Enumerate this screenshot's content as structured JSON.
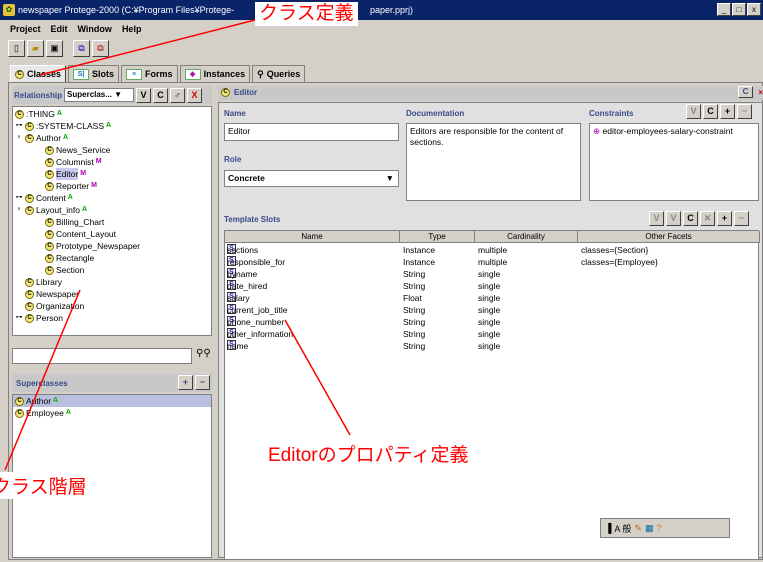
{
  "window": {
    "title": "newspaper  Protege-2000   (C:¥Program Files¥Protege-",
    "title_tail": "paper.pprj)",
    "min": "_",
    "max": "□",
    "close": "x"
  },
  "menu": [
    "Project",
    "Edit",
    "Window",
    "Help"
  ],
  "tabs": [
    {
      "label": "Classes",
      "icon": "C"
    },
    {
      "label": "Slots",
      "icon": "S"
    },
    {
      "label": "Forms",
      "icon": "F"
    },
    {
      "label": "Instances",
      "icon": "I"
    },
    {
      "label": "Queries",
      "icon": "Q"
    }
  ],
  "left": {
    "relationship_label": "Relationship",
    "relationship_value": "Superclas...",
    "v_btn": "V",
    "c_btn": "C",
    "x_btn": "X",
    "tree": [
      {
        "label": ":THING",
        "flag": "A"
      },
      {
        "label": ":SYSTEM-CLASS",
        "flag": "A"
      },
      {
        "label": "Author",
        "flag": "A"
      },
      {
        "label": "News_Service",
        "flag": ""
      },
      {
        "label": "Columnist",
        "flag": "M"
      },
      {
        "label": "Editor",
        "flag": "M"
      },
      {
        "label": "Reporter",
        "flag": "M"
      },
      {
        "label": "Content",
        "flag": "A"
      },
      {
        "label": "Layout_info",
        "flag": "A"
      },
      {
        "label": "Billing_Chart",
        "flag": ""
      },
      {
        "label": "Content_Layout",
        "flag": ""
      },
      {
        "label": "Prototype_Newspaper",
        "flag": ""
      },
      {
        "label": "Rectangle",
        "flag": ""
      },
      {
        "label": "Section",
        "flag": ""
      },
      {
        "label": "Library",
        "flag": ""
      },
      {
        "label": "Newspaper",
        "flag": ""
      },
      {
        "label": "Organization",
        "flag": ""
      },
      {
        "label": "Person",
        "flag": ""
      }
    ],
    "superclasses_label": "Superclasses",
    "superclasses": [
      {
        "label": "Author",
        "flag": "A"
      },
      {
        "label": "Employee",
        "flag": "A"
      }
    ]
  },
  "editor": {
    "header": "Editor",
    "name_label": "Name",
    "name_value": "Editor",
    "doc_label": "Documentation",
    "doc_value": "Editors are responsible for the content of sections.",
    "constraints_label": "Constraints",
    "constraint": "editor-employees-salary-constraint",
    "role_label": "Role",
    "role_value": "Concrete",
    "template_label": "Template Slots",
    "columns": [
      "Name",
      "Type",
      "Cardinality",
      "Other Facets"
    ],
    "slots": [
      {
        "name": "sections",
        "type": "Instance",
        "card": "multiple",
        "facets": "classes={Section}"
      },
      {
        "name": "responsible_for",
        "type": "Instance",
        "card": "multiple",
        "facets": "classes={Employee}"
      },
      {
        "name": "byname",
        "type": "String",
        "card": "single",
        "facets": ""
      },
      {
        "name": "date_hired",
        "type": "String",
        "card": "single",
        "facets": ""
      },
      {
        "name": "salary",
        "type": "Float",
        "card": "single",
        "facets": ""
      },
      {
        "name": "current_job_title",
        "type": "String",
        "card": "single",
        "facets": ""
      },
      {
        "name": "phone_number",
        "type": "String",
        "card": "single",
        "facets": ""
      },
      {
        "name": "other_information",
        "type": "String",
        "card": "single",
        "facets": ""
      },
      {
        "name": "name",
        "type": "String",
        "card": "single",
        "facets": ""
      }
    ]
  },
  "annotations": {
    "class_def": "クラス定義",
    "class_hier": "クラス階層",
    "editor_props": "Editorのプロパティ定義"
  },
  "ime": {
    "text": "A 般"
  },
  "colors": {
    "annotation": "#ff0000",
    "titlebar": "#0a246a"
  }
}
